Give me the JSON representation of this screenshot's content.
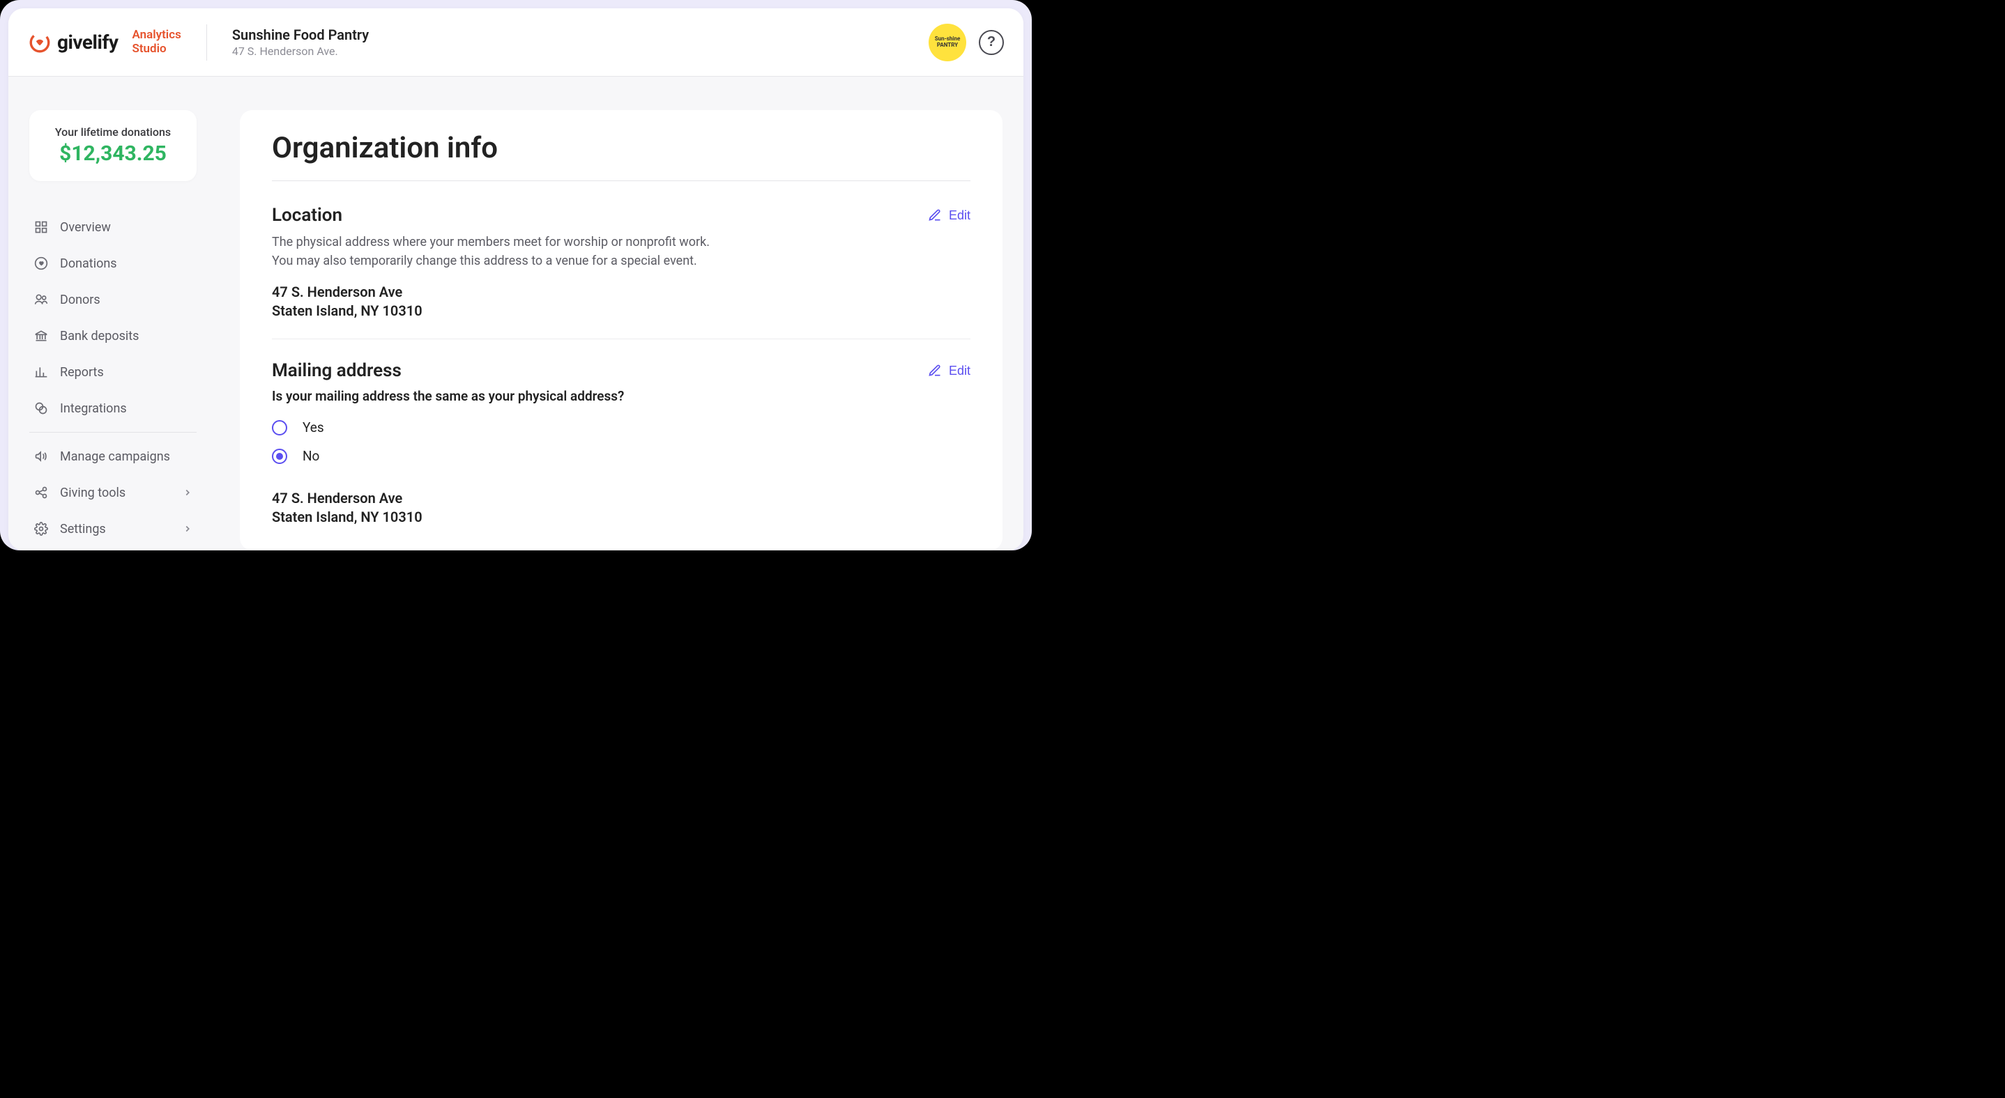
{
  "brand": {
    "word": "givelify",
    "sub_line1": "Analytics",
    "sub_line2": "Studio"
  },
  "header": {
    "org_name": "Sunshine Food Pantry",
    "org_address": "47 S. Henderson Ave.",
    "avatar_text": "Sun-shine PANTRY"
  },
  "lifetime": {
    "label": "Your lifetime donations",
    "amount": "$12,343.25"
  },
  "nav": {
    "items": [
      {
        "label": "Overview"
      },
      {
        "label": "Donations"
      },
      {
        "label": "Donors"
      },
      {
        "label": "Bank deposits"
      },
      {
        "label": "Reports"
      },
      {
        "label": "Integrations"
      }
    ],
    "items2": [
      {
        "label": "Manage campaigns"
      },
      {
        "label": "Giving tools"
      },
      {
        "label": "Settings"
      }
    ]
  },
  "page": {
    "title": "Organization info",
    "edit_label": "Edit",
    "location": {
      "heading": "Location",
      "desc_line1": "The physical address where your members meet for worship or nonprofit work.",
      "desc_line2": "You may also temporarily change this address to a venue for a special event.",
      "addr_line1": "47 S. Henderson Ave",
      "addr_line2": "Staten Island, NY 10310"
    },
    "mailing": {
      "heading": "Mailing address",
      "question": "Is your mailing address the same as your physical address?",
      "opt_yes": "Yes",
      "opt_no": "No",
      "addr_line1": "47 S. Henderson Ave",
      "addr_line2": "Staten Island, NY 10310"
    }
  }
}
